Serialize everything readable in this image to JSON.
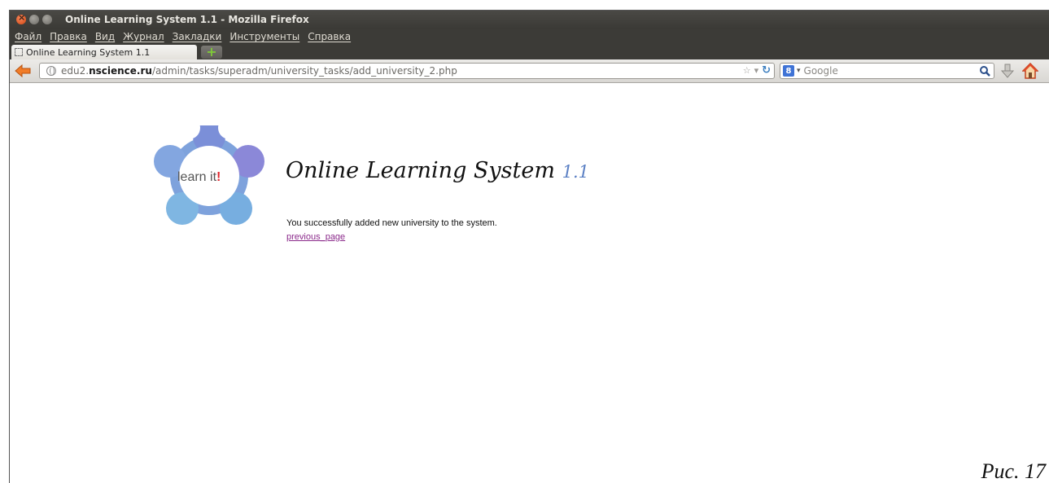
{
  "window": {
    "title": "Online Learning System 1.1 - Mozilla Firefox"
  },
  "menu": [
    "Файл",
    "Правка",
    "Вид",
    "Журнал",
    "Закладки",
    "Инструменты",
    "Справка"
  ],
  "tab": {
    "label": "Online Learning System 1.1",
    "new_tab_symbol": "+"
  },
  "navbar": {
    "url_host_prefix": "edu2.",
    "url_host": "nscience.ru",
    "url_path": "/admin/tasks/superadm/university_tasks/add_university_2.php",
    "search_placeholder": "Google",
    "search_engine_letter": "8"
  },
  "page": {
    "logo_text": "learn it",
    "logo_exclaim": "!",
    "title": "Online Learning System",
    "version": "1.1",
    "message": "You successfully added new university to the system.",
    "link": "previous_page"
  },
  "caption": "Рис. 17",
  "colors": {
    "titlebar": "#3c3b37",
    "url_text": "#6c6a66",
    "version": "#5b80c4",
    "visited_link": "#8b2a8b",
    "logo_blue": "#7ea2dc",
    "logo_violet": "#8b88d8"
  },
  "icons": [
    "close-icon",
    "minimize-icon",
    "maximize-icon",
    "back-arrow-icon",
    "globe-icon",
    "star-icon",
    "reload-icon",
    "search-engine-icon",
    "magnifier-icon",
    "download-icon",
    "home-icon"
  ]
}
